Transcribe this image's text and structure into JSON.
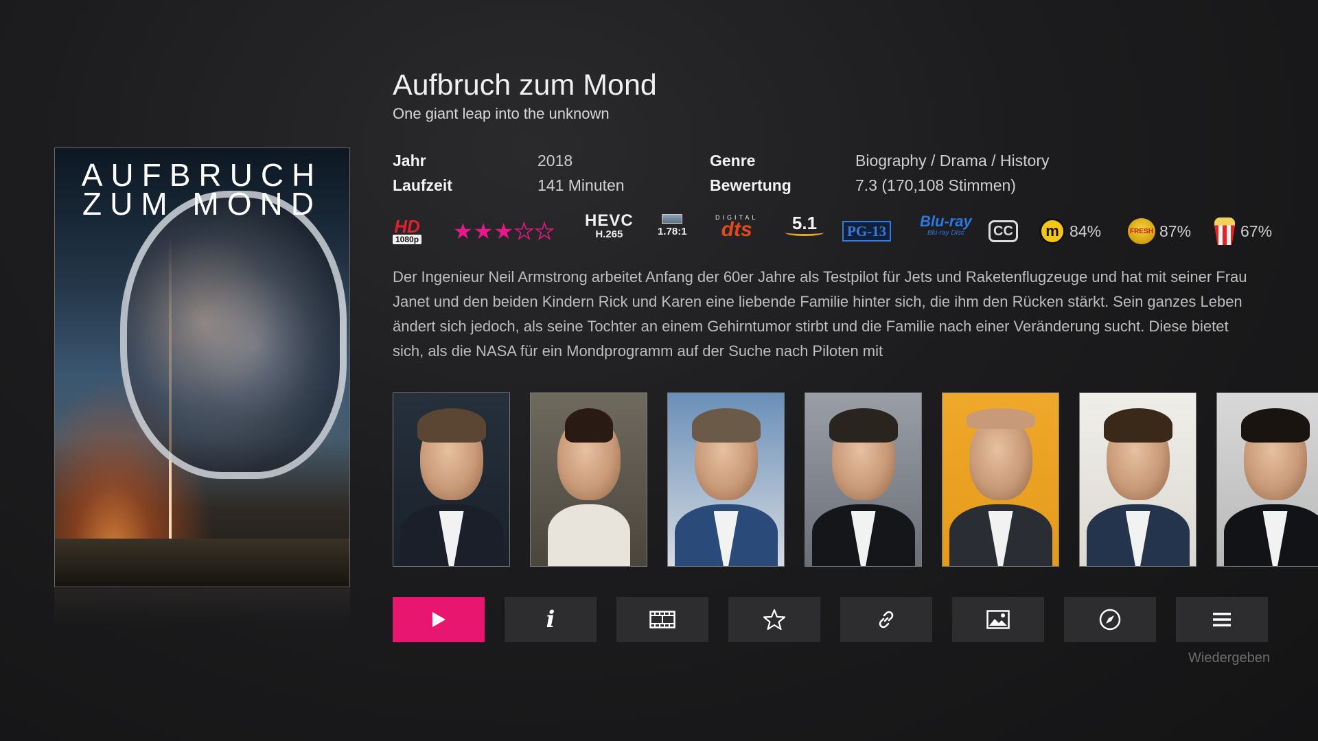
{
  "movie": {
    "title": "Aufbruch zum Mond",
    "tagline": "One giant leap into the unknown",
    "poster_title": "AUFBRUCH\nZUM MOND"
  },
  "meta": {
    "year_label": "Jahr",
    "year_value": "2018",
    "runtime_label": "Laufzeit",
    "runtime_value": "141 Minuten",
    "genre_label": "Genre",
    "genre_value": "Biography / Drama / History",
    "rating_label": "Bewertung",
    "rating_value": "7.3 (170,108 Stimmen)"
  },
  "badges": {
    "hd": "HD",
    "resolution": "1080p",
    "stars_filled": 3,
    "stars_total": 5,
    "codec_top": "HEVC",
    "codec_bottom": "H.265",
    "aspect": "1.78:1",
    "audio_top": "DIGITAL",
    "audio_brand": "dts",
    "channels": "5.1",
    "mpaa": "PG-13",
    "disc": "Blu-ray",
    "disc_sub": "Blu-ray Disc",
    "subtitles": "CC",
    "metacritic_letter": "m",
    "metacritic_pct": "84%",
    "rt_icon_text": "FRESH",
    "rt_pct": "87%",
    "audience_pct": "67%"
  },
  "plot": "Der Ingenieur Neil Armstrong arbeitet Anfang der 60er Jahre als Testpilot für Jets und Raketenflugzeuge und hat mit seiner Frau Janet und den beiden Kindern Rick und Karen eine liebende Familie hinter sich, die ihm den Rücken stärkt. Sein ganzes Leben ändert sich jedoch, als seine Tochter an einem Gehirntumor stirbt und die Familie nach einer Veränderung sucht. Diese bietet sich, als die NASA für ein Mondprogramm auf der Suche nach Piloten mit",
  "cast_count_visible": 7,
  "actions": {
    "play_icon": "play-icon",
    "info_icon": "info-icon",
    "trailer_icon": "film-icon",
    "favorite_icon": "star-icon",
    "link_icon": "link-icon",
    "artwork_icon": "image-icon",
    "browser_icon": "compass-icon",
    "menu_icon": "menu-icon",
    "info_glyph": "i",
    "status_text": "Wiedergeben"
  },
  "colors": {
    "accent": "#e8166e",
    "stars": "#e8188a"
  }
}
